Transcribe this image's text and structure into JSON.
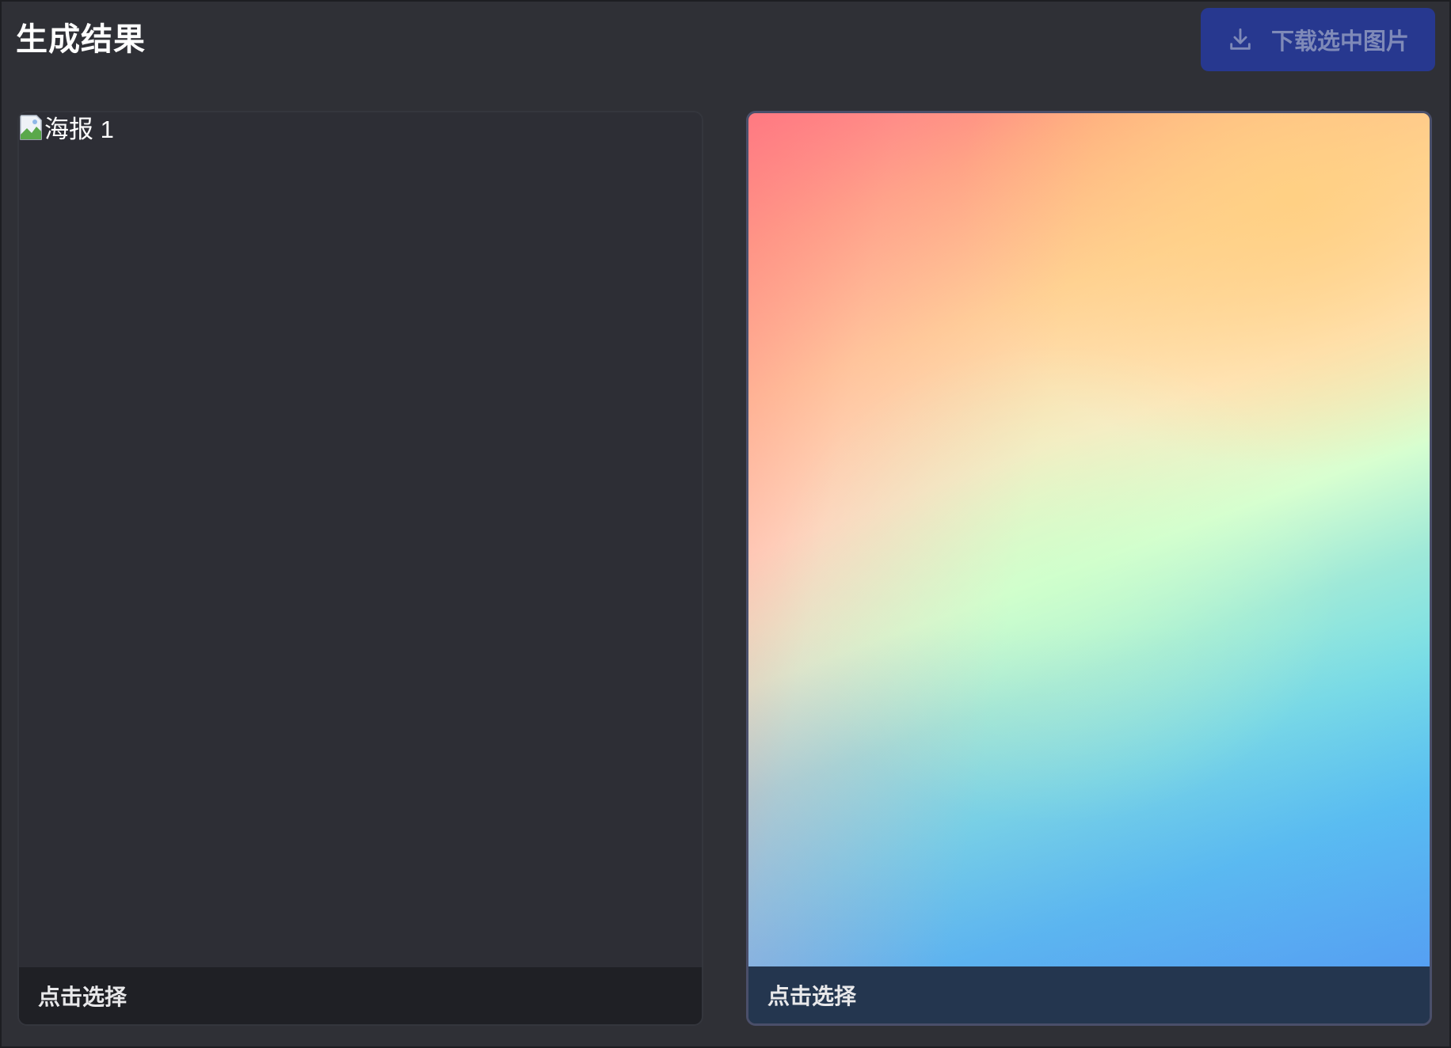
{
  "header": {
    "title": "生成结果",
    "download_button": {
      "label": "下载选中图片",
      "icon": "download-icon",
      "enabled": false
    }
  },
  "cards": [
    {
      "image_alt": "海报 1",
      "image_status": "broken",
      "caption": "点击选择",
      "selected": false
    },
    {
      "image_alt": "",
      "image_status": "loaded",
      "caption": "点击选择",
      "selected": true
    }
  ],
  "colors": {
    "background": "#2f3036",
    "button_bg": "#27388f",
    "button_text": "#7f8ab8",
    "caption_bg": "#1f2025",
    "caption_bg_selected": "#24364f",
    "selected_border": "#4a4f6a"
  }
}
